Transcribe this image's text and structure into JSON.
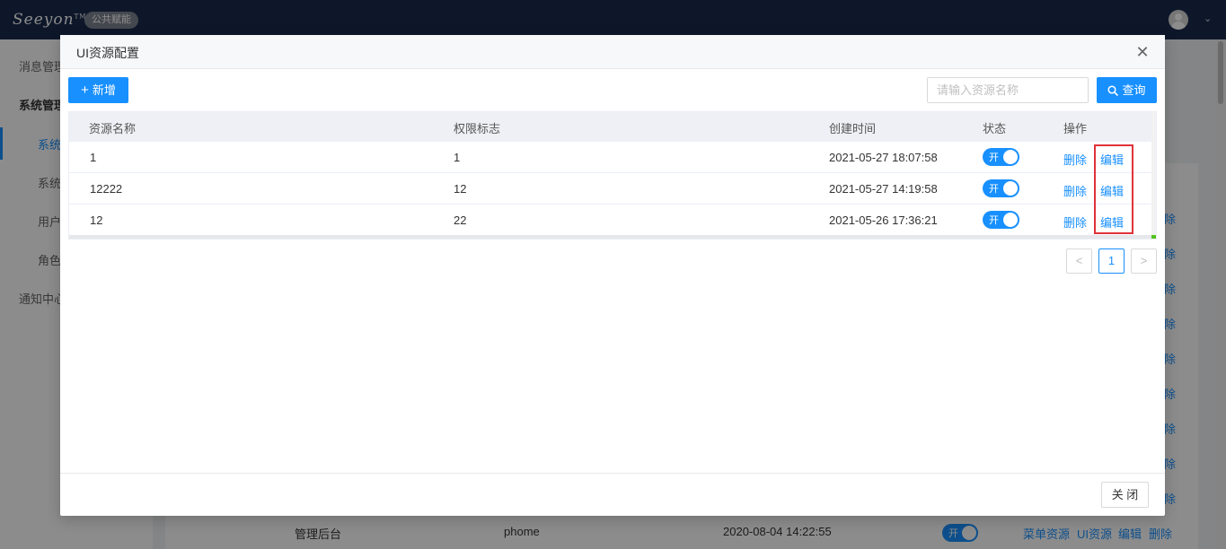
{
  "topbar": {
    "logo_text": "Seeyon",
    "logo_tm": "TM",
    "tag": "公共赋能",
    "avatar_icon": "user-avatar-icon",
    "dropdown_icon": "chevron-down-icon"
  },
  "sidebar": {
    "items": [
      {
        "label": "消息管理"
      },
      {
        "label": "系统管理"
      },
      {
        "label": "系统"
      },
      {
        "label": "系统"
      },
      {
        "label": "用户"
      },
      {
        "label": "角色"
      },
      {
        "label": "通知中心"
      }
    ]
  },
  "background_table": {
    "row_actions": [
      "除",
      "除",
      "除",
      "除",
      "除",
      "除",
      "除",
      "除",
      "除"
    ],
    "last_row": {
      "name": "管理后台",
      "code": "phome",
      "time": "2020-08-04 14:22:55",
      "status": "开",
      "actions": [
        "菜单资源",
        "UI资源",
        "编辑",
        "删除"
      ]
    }
  },
  "modal": {
    "title": "UI资源配置",
    "close_icon": "close-icon",
    "add_button": "新增",
    "add_icon": "plus-icon",
    "search_placeholder": "请输入资源名称",
    "search_value": "",
    "search_button": "查询",
    "search_icon": "search-icon",
    "columns": [
      "资源名称",
      "权限标志",
      "创建时间",
      "状态",
      "操作"
    ],
    "rows": [
      {
        "name": "1",
        "code": "1",
        "time": "2021-05-27 18:07:58",
        "status": "开",
        "status_on": true,
        "delete": "删除",
        "edit": "编辑"
      },
      {
        "name": "12222",
        "code": "12",
        "time": "2021-05-27 14:19:58",
        "status": "开",
        "status_on": true,
        "delete": "删除",
        "edit": "编辑"
      },
      {
        "name": "12",
        "code": "22",
        "time": "2021-05-26 17:36:21",
        "status": "开",
        "status_on": true,
        "delete": "删除",
        "edit": "编辑"
      }
    ],
    "pagination": {
      "prev": "<",
      "current": "1",
      "next": ">"
    },
    "footer_close": "关 闭"
  },
  "colors": {
    "primary": "#1890ff",
    "topbar": "#1b2b4d",
    "highlight": "#e0323a"
  }
}
